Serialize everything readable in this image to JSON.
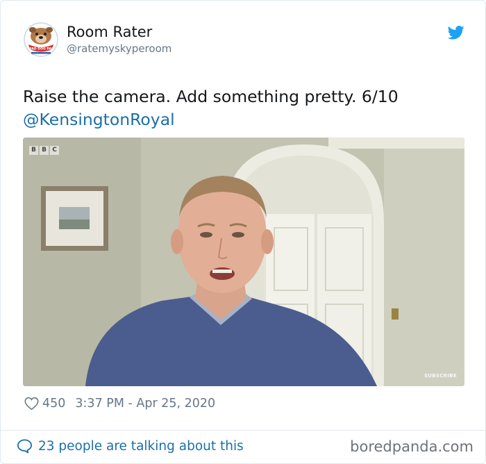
{
  "author": {
    "display_name": "Room Rater",
    "handle": "@ratemyskyperoom",
    "avatar": {
      "icon": "bulldog-mascot-logo",
      "logo_text": "MAD DOG PAC"
    }
  },
  "twitter_icon": "twitter-bird-icon",
  "tweet": {
    "text": "Raise the camera. Add something pretty. 6/10",
    "mention": "@KensingtonRoyal"
  },
  "media": {
    "broadcaster_logo": [
      "B",
      "B",
      "C"
    ],
    "overlay_text": "SUBSCRIBE"
  },
  "meta": {
    "like_icon": "heart-outline-icon",
    "likes": "450",
    "timestamp": "3:37 PM - Apr 25, 2020"
  },
  "footer": {
    "conversation_icon": "speech-bubble-icon",
    "conversation_text": "23 people are talking about this",
    "watermark": "boredpanda.com"
  },
  "colors": {
    "link": "#1b6fa8",
    "twitter_blue": "#1da1f2",
    "muted": "#657786"
  }
}
